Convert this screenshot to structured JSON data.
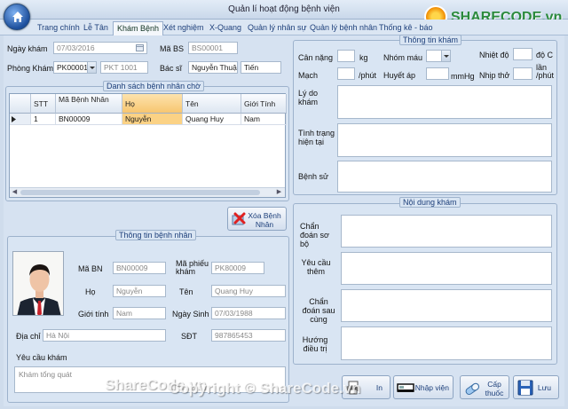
{
  "window": {
    "title": "Quản lí hoạt động bệnh viện"
  },
  "logo": {
    "text": "SHARECODE.vn"
  },
  "tabs": [
    "Trang chính",
    "Lễ Tân",
    "Khám Bệnh",
    "Xét nghiệm",
    "X-Quang",
    "Quản lý nhân sự",
    "Quản lý bệnh nhân",
    "Thống kê - báo"
  ],
  "exam_form": {
    "ngay_kham_label": "Ngày khám",
    "ngay_kham_value": "07/03/2016",
    "ma_bs_label": "Mã BS",
    "ma_bs_value": "BS00001",
    "phong_kham_label": "Phòng Khám",
    "phong_kham_value": "PK00001",
    "phong_kham_name": "PKT 1001",
    "bac_si_label": "Bác sĩ",
    "bac_si_ho": "Nguyễn Thuậ",
    "bac_si_ten": "Tiến"
  },
  "waiting_list": {
    "title": "Danh sách bệnh nhân chờ",
    "columns": [
      "STT",
      "Mã Bệnh Nhân",
      "Họ",
      "Tên",
      "Giới Tính"
    ],
    "rows": [
      {
        "stt": "1",
        "ma": "BN00009",
        "ho": "Nguyễn",
        "ten": "Quang Huy",
        "gioi_tinh": "Nam"
      }
    ]
  },
  "delete_button": {
    "label": "Xóa Bệnh Nhân"
  },
  "patient_info": {
    "title": "Thông tin bệnh nhân",
    "ma_bn_label": "Mã BN",
    "ma_bn_value": "BN00009",
    "ma_phieu_label": "Mã phiếu khám",
    "ma_phieu_value": "PK80009",
    "ho_label": "Họ",
    "ho_value": "Nguyễn",
    "ten_label": "Tên",
    "ten_value": "Quang Huy",
    "gioi_tinh_label": "Giới tính",
    "gioi_tinh_value": "Nam",
    "ngay_sinh_label": "Ngày Sinh",
    "ngay_sinh_value": "07/03/1988",
    "dia_chi_label": "Địa chỉ",
    "dia_chi_value": "Hà Nội",
    "sdt_label": "SĐT",
    "sdt_value": "987865453",
    "yeu_cau_label": "Yêu cầu khám",
    "yeu_cau_value": "Khám tổng quát"
  },
  "exam_info": {
    "title": "Thông tin khám",
    "can_nang_label": "Cân nặng",
    "can_nang_unit": "kg",
    "nhom_mau_label": "Nhóm máu",
    "nhiet_do_label": "Nhiệt độ",
    "nhiet_do_unit": "độ C",
    "mach_label": "Mạch",
    "mach_unit": "/phút",
    "huyet_ap_label": "Huyết áp",
    "huyet_ap_unit": "mmHg",
    "nhip_tho_label": "Nhịp thở",
    "nhip_tho_unit": "lần /phút",
    "ly_do_label": "Lý do khám",
    "tinh_trang_label": "Tình trạng hiện tại",
    "benh_su_label": "Bệnh sử"
  },
  "exam_content": {
    "title": "Nội dung khám",
    "chan_doan_so_bo_label": "Chẩn đoán sơ bộ",
    "yeu_cau_them_label": "Yêu cầu thêm",
    "chan_doan_sau_label": "Chẩn đoán sau cùng",
    "huong_dieu_tri_label": "Hướng điều trị"
  },
  "actions": {
    "in_label": "In",
    "nhap_vien_label": "Nhập viện",
    "cap_thuoc_label": "Cấp thuốc",
    "luu_label": "Lưu"
  },
  "watermarks": {
    "left": "ShareCode.vn",
    "center": "Copyright © ShareCode.vn"
  },
  "colors": {
    "accent": "#1d3f7a",
    "selection": "#fbd285",
    "background": "#d6e2f1"
  }
}
